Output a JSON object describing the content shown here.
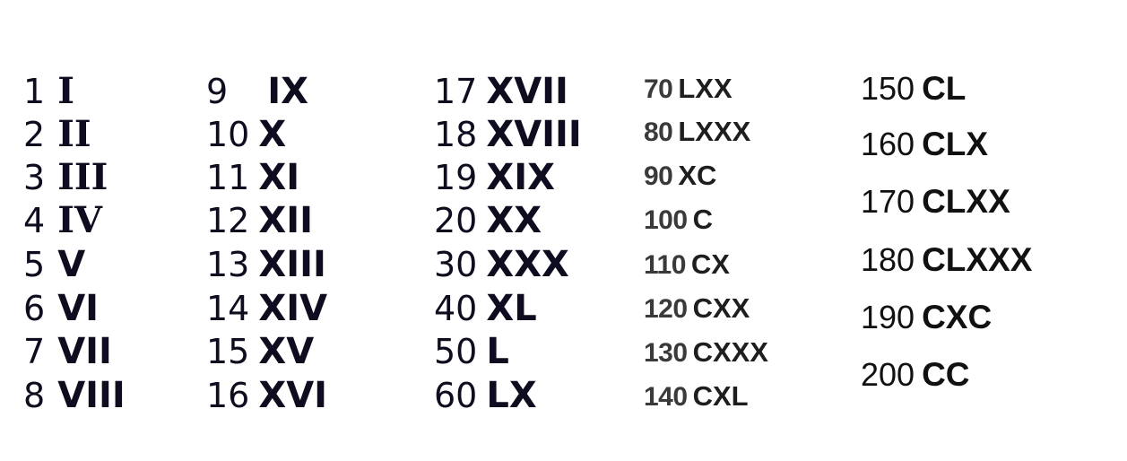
{
  "columns": [
    {
      "rows": [
        {
          "num": "1",
          "roman": "I"
        },
        {
          "num": "2",
          "roman": "II"
        },
        {
          "num": "3",
          "roman": "III"
        },
        {
          "num": "4",
          "roman": "IV"
        },
        {
          "num": "5",
          "roman": "V"
        },
        {
          "num": "6",
          "roman": "VI"
        },
        {
          "num": "7",
          "roman": "VII"
        },
        {
          "num": "8",
          "roman": "VIII"
        }
      ]
    },
    {
      "rows": [
        {
          "num": "9",
          "roman": "IX"
        },
        {
          "num": "10",
          "roman": "X"
        },
        {
          "num": "11",
          "roman": "XI"
        },
        {
          "num": "12",
          "roman": "XII"
        },
        {
          "num": "13",
          "roman": "XIII"
        },
        {
          "num": "14",
          "roman": "XIV"
        },
        {
          "num": "15",
          "roman": "XV"
        },
        {
          "num": "16",
          "roman": "XVI"
        }
      ]
    },
    {
      "rows": [
        {
          "num": "17",
          "roman": "XVII"
        },
        {
          "num": "18",
          "roman": "XVIII"
        },
        {
          "num": "19",
          "roman": "XIX"
        },
        {
          "num": "20",
          "roman": "XX"
        },
        {
          "num": "30",
          "roman": "XXX"
        },
        {
          "num": "40",
          "roman": "XL"
        },
        {
          "num": "50",
          "roman": "L"
        },
        {
          "num": "60",
          "roman": "LX"
        }
      ]
    },
    {
      "rows": [
        {
          "num": "70",
          "roman": "LXX"
        },
        {
          "num": "80",
          "roman": "LXXX"
        },
        {
          "num": "90",
          "roman": "XC"
        },
        {
          "num": "100",
          "roman": "C"
        },
        {
          "num": "110",
          "roman": "CX"
        },
        {
          "num": "120",
          "roman": "CXX"
        },
        {
          "num": "130",
          "roman": "CXXX"
        },
        {
          "num": "140",
          "roman": "CXL"
        }
      ]
    },
    {
      "rows": [
        {
          "num": "150",
          "roman": "CL"
        },
        {
          "num": "160",
          "roman": "CLX"
        },
        {
          "num": "170",
          "roman": "CLXX"
        },
        {
          "num": "180",
          "roman": "CLXXX"
        },
        {
          "num": "190",
          "roman": "CXC"
        },
        {
          "num": "200",
          "roman": "CC"
        }
      ]
    }
  ]
}
